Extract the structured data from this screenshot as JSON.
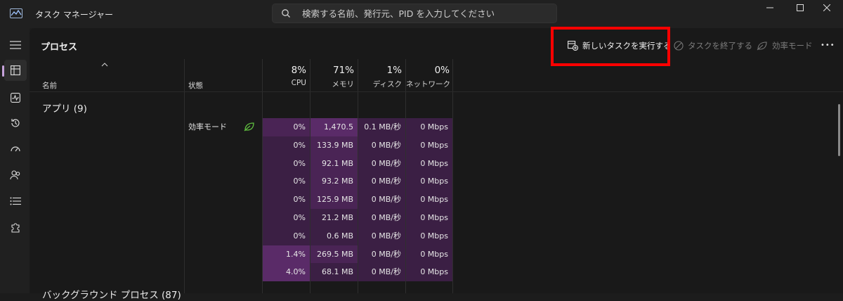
{
  "window": {
    "title": "タスク マネージャー",
    "search_placeholder": "検索する名前、発行元、PID を入力してください"
  },
  "page": {
    "title": "プロセス"
  },
  "toolbar": {
    "run_new_task": "新しいタスクを実行する",
    "end_task": "タスクを終了する",
    "efficiency_mode": "効率モード",
    "more": "•••"
  },
  "columns": {
    "name": "名前",
    "status": "状態",
    "cpu_pct": "8%",
    "cpu": "CPU",
    "memory_pct": "71%",
    "memory": "メモリ",
    "disk_pct": "1%",
    "disk": "ディスク",
    "network_pct": "0%",
    "network": "ネットワーク"
  },
  "groups": {
    "apps": "アプリ (9)",
    "background": "バックグラウンド プロセス (87)"
  },
  "rows": [
    {
      "status": "効率モード",
      "cpu": "0%",
      "memory": "1,470.5 MB",
      "disk": "0.1 MB/秒",
      "network": "0 Mbps"
    },
    {
      "status": "",
      "cpu": "0%",
      "memory": "133.9 MB",
      "disk": "0 MB/秒",
      "network": "0 Mbps"
    },
    {
      "status": "",
      "cpu": "0%",
      "memory": "92.1 MB",
      "disk": "0 MB/秒",
      "network": "0 Mbps"
    },
    {
      "status": "",
      "cpu": "0%",
      "memory": "93.2 MB",
      "disk": "0 MB/秒",
      "network": "0 Mbps"
    },
    {
      "status": "",
      "cpu": "0%",
      "memory": "125.9 MB",
      "disk": "0 MB/秒",
      "network": "0 Mbps"
    },
    {
      "status": "",
      "cpu": "0%",
      "memory": "21.2 MB",
      "disk": "0 MB/秒",
      "network": "0 Mbps"
    },
    {
      "status": "",
      "cpu": "0%",
      "memory": "0.6 MB",
      "disk": "0 MB/秒",
      "network": "0 Mbps"
    },
    {
      "status": "",
      "cpu": "1.4%",
      "memory": "269.5 MB",
      "disk": "0 MB/秒",
      "network": "0 Mbps"
    },
    {
      "status": "",
      "cpu": "4.0%",
      "memory": "68.1 MB",
      "disk": "0 MB/秒",
      "network": "0 Mbps"
    }
  ],
  "colors": {
    "accent": "#c7a3dc",
    "highlight_box": "#ff0000",
    "heat_light": "#3b1f44",
    "heat_medium": "#4a2455",
    "heat_strong": "#5a2b68",
    "leaf_green": "#5fbf3f"
  },
  "icons": {
    "sidebar": [
      "menu-icon",
      "processes-icon",
      "performance-icon",
      "app-history-icon",
      "startup-apps-icon",
      "users-icon",
      "details-icon",
      "services-icon"
    ]
  }
}
